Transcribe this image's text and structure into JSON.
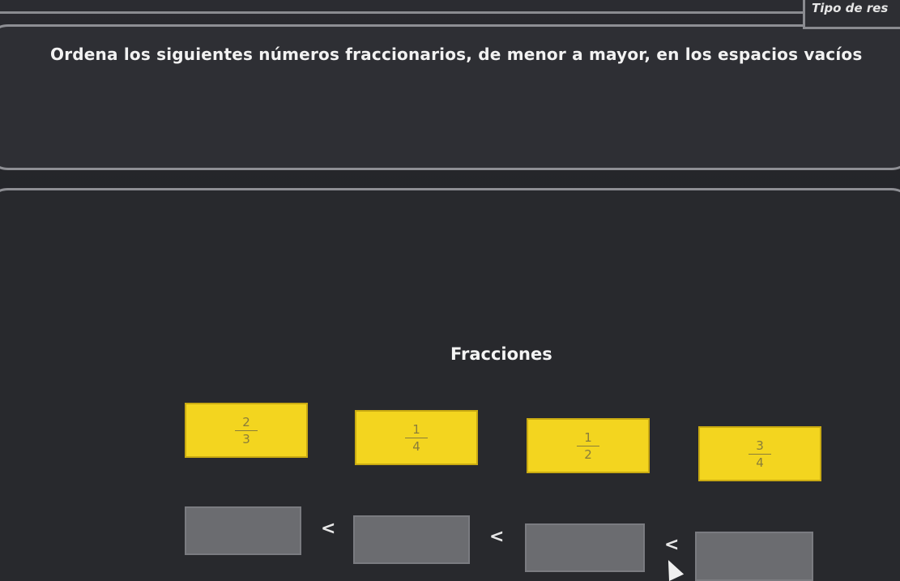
{
  "header": {
    "type_label": "Tipo de res"
  },
  "question": {
    "text": "Ordena los siguientes números fraccionarios, de menor a mayor, en los espacios vacíos"
  },
  "section": {
    "title": "Fracciones"
  },
  "fractions": [
    {
      "numerator": "2",
      "denominator": "3"
    },
    {
      "numerator": "1",
      "denominator": "4"
    },
    {
      "numerator": "1",
      "denominator": "2"
    },
    {
      "numerator": "3",
      "denominator": "4"
    }
  ],
  "comparison": {
    "symbol": "<"
  },
  "colors": {
    "card": "#f3d51f",
    "slot": "#6b6c70",
    "background": "#28292d"
  }
}
